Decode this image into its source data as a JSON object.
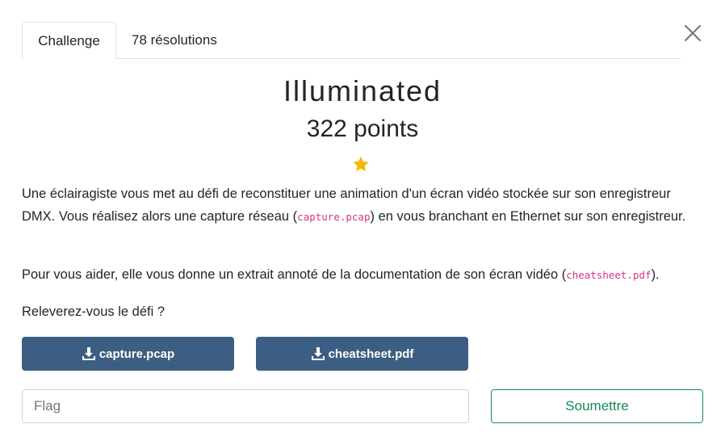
{
  "tabs": [
    {
      "label": "Challenge"
    },
    {
      "label": "78 résolutions"
    }
  ],
  "challenge": {
    "title": "Illuminated",
    "points": "322 points",
    "description": {
      "p1_a": "Une éclairagiste vous met au défi de reconstituer une animation d'un écran vidéo stockée sur son enregistreur DMX. Vous réalisez alors une capture réseau (",
      "p1_code": "capture.pcap",
      "p1_b": ") en vous branchant en Ethernet sur son enregistreur.",
      "p2_a": "Pour vous aider, elle vous donne un extrait annoté de la documentation de son écran vidéo (",
      "p2_code": "cheatsheet.pdf",
      "p2_b": ").",
      "p3": "Releverez-vous le défi ?"
    }
  },
  "downloads": [
    {
      "label": "capture.pcap",
      "icon": "download-icon"
    },
    {
      "label": "cheatsheet.pdf",
      "icon": "download-icon"
    }
  ],
  "flag_input": {
    "placeholder": "Flag",
    "value": ""
  },
  "submit_label": "Soumettre",
  "colors": {
    "download_button": "#3d5e83",
    "submit_accent": "#198754",
    "star": "#f5b700",
    "code": "#d63384"
  }
}
